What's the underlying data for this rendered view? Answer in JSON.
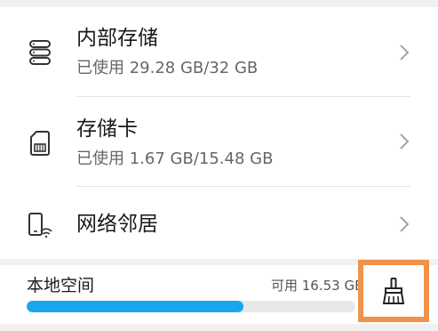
{
  "storage_items": [
    {
      "title": "内部存储",
      "subtitle": "已使用 29.28 GB/32 GB",
      "icon": "internal-storage-icon"
    },
    {
      "title": "存储卡",
      "subtitle": "已使用 1.67 GB/15.48 GB",
      "icon": "sd-card-icon"
    },
    {
      "title": "网络邻居",
      "icon": "network-neighbor-icon"
    }
  ],
  "local_space": {
    "label": "本地空间",
    "available": "可用 16.53 GB",
    "used_fraction": 0.66,
    "bar_color": "#1aa6ec"
  },
  "clean_button": {
    "icon": "broom-icon",
    "highlight_color": "#f0924a"
  }
}
